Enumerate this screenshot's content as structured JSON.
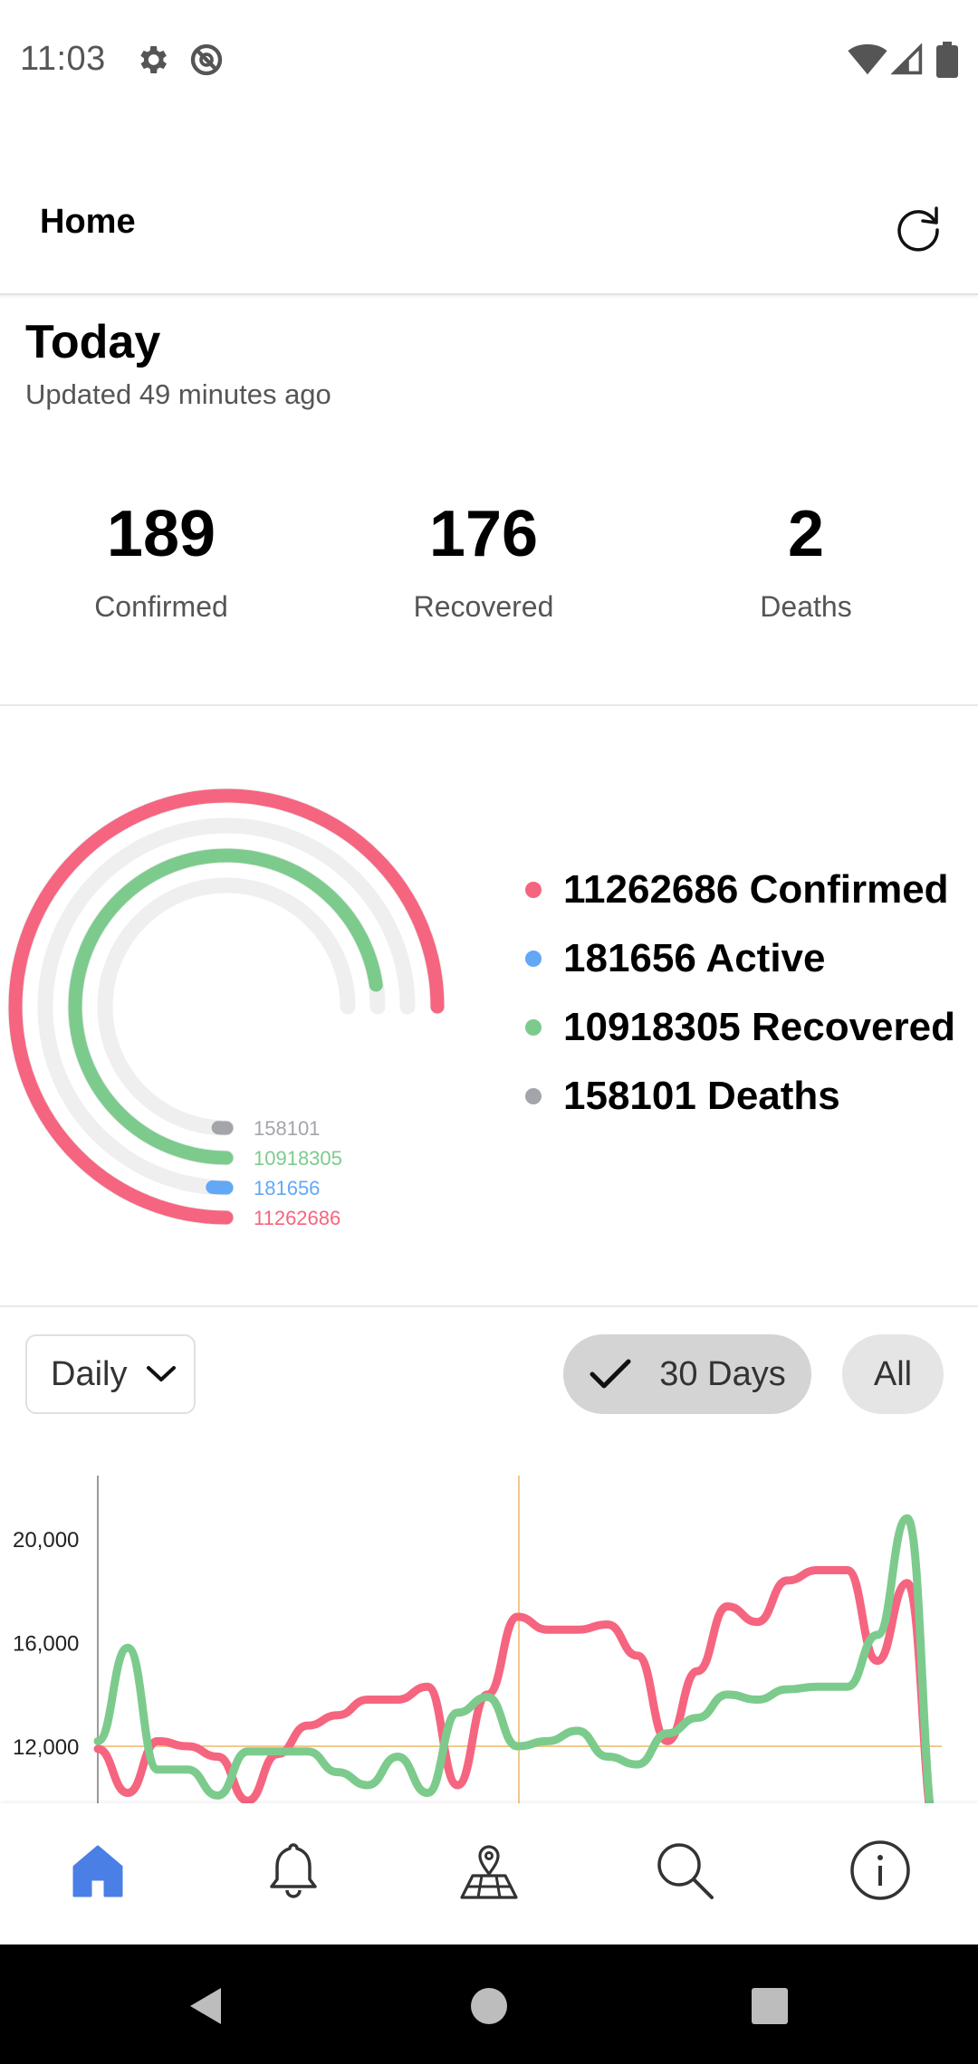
{
  "status_bar": {
    "time": "11:03"
  },
  "app_bar": {
    "title": "Home"
  },
  "today": {
    "title": "Today",
    "updated": "Updated 49 minutes ago",
    "stats": [
      {
        "value": "189",
        "label": "Confirmed"
      },
      {
        "value": "176",
        "label": "Recovered"
      },
      {
        "value": "2",
        "label": "Deaths"
      }
    ]
  },
  "totals": {
    "items": [
      {
        "value": "11262686",
        "label": "11262686 Confirmed",
        "color": "#f5657f"
      },
      {
        "value": "181656",
        "label": "181656 Active",
        "color": "#62a8f5"
      },
      {
        "value": "10918305",
        "label": "10918305 Recovered",
        "color": "#7ccb8d"
      },
      {
        "value": "158101",
        "label": "158101 Deaths",
        "color": "#a3a5aa"
      }
    ],
    "ring_labels": [
      "158101",
      "10918305",
      "181656",
      "11262686"
    ]
  },
  "controls": {
    "period": "Daily",
    "range_selected": "30 Days",
    "range_other": "All"
  },
  "chart_data": {
    "type": "line",
    "title": "",
    "xlabel": "",
    "ylabel": "",
    "y_ticks": [
      "20,000",
      "16,000",
      "12,000"
    ],
    "ylim": [
      9800,
      22800
    ],
    "x": [
      1,
      2,
      3,
      4,
      5,
      6,
      7,
      8,
      9,
      10,
      11,
      12,
      13,
      14,
      15,
      16,
      17,
      18,
      19,
      20,
      21,
      22,
      23,
      24,
      25,
      26,
      27,
      28,
      29,
      30,
      31
    ],
    "reference_y": 12000,
    "series": [
      {
        "color": "#f5657f",
        "values": [
          11900,
          10200,
          12200,
          12000,
          11600,
          9900,
          11700,
          12800,
          13200,
          13800,
          13800,
          14300,
          10500,
          14000,
          17000,
          16500,
          16500,
          16700,
          15500,
          12200,
          14900,
          17400,
          16800,
          18400,
          18800,
          18800,
          15300,
          18300,
          8500
        ]
      },
      {
        "color": "#7ccb8d",
        "values": [
          12200,
          15800,
          11100,
          11100,
          10100,
          11800,
          11800,
          11800,
          11000,
          10500,
          11600,
          10200,
          13300,
          13900,
          12000,
          12200,
          12600,
          11600,
          11300,
          12500,
          13100,
          14000,
          13800,
          14200,
          14300,
          14300,
          16300,
          20800,
          8500
        ]
      }
    ]
  },
  "bottom_nav": {
    "items": [
      "home-icon",
      "bell-icon",
      "map-icon",
      "search-icon",
      "info-icon"
    ],
    "active_color": "#4a7fe5"
  },
  "system_nav": {
    "items": [
      "back-icon",
      "home-circle-icon",
      "recents-icon"
    ]
  }
}
